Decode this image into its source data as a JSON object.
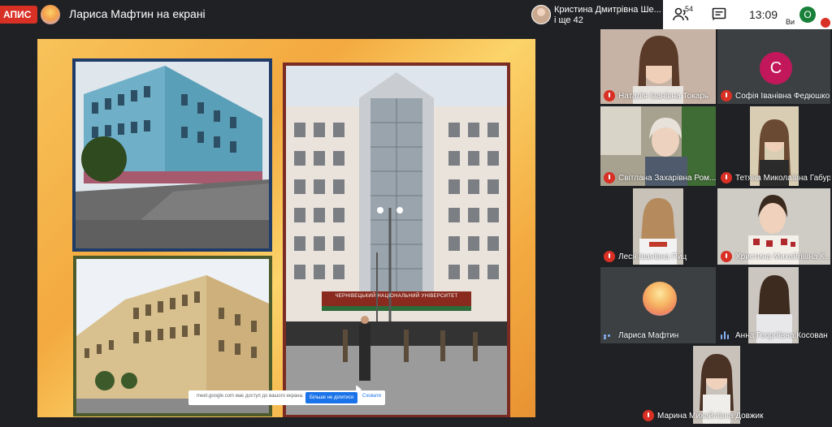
{
  "header": {
    "recording_label": "АПИС",
    "presenter_title": "Лариса Мафтин на екрані",
    "participant_name": "Кристина Дмитрівна Ше...",
    "participant_more": "і ще 42",
    "people_count": "54",
    "time": "13:09",
    "self_initial": "О",
    "self_label": "Ви"
  },
  "share_bar": {
    "text": "meet.google.com має доступ до вашого екрана.",
    "stop_label": "Більше не ділитися",
    "hide_label": "Сховати"
  },
  "slide": {
    "sign_text": "ЧЕРНІВЕЦЬКИЙ НАЦІОНАЛЬНИЙ УНІВЕРСИТЕТ"
  },
  "tiles": [
    {
      "name": "Наталія Іванівна Токарь"
    },
    {
      "name": "Софія Іванівна Федюшко",
      "initial": "С"
    },
    {
      "name": "Світлана Захарівна Ром..."
    },
    {
      "name": "Тетяна Миколаївна Габур"
    },
    {
      "name": "Леся Іванівна Пиц"
    },
    {
      "name": "Христина Михайлівна К..."
    },
    {
      "name": "Лариса Мафтин"
    },
    {
      "name": "Анна Георгіївна Косован"
    },
    {
      "name": "Марина Михайлівна Довжик"
    }
  ]
}
